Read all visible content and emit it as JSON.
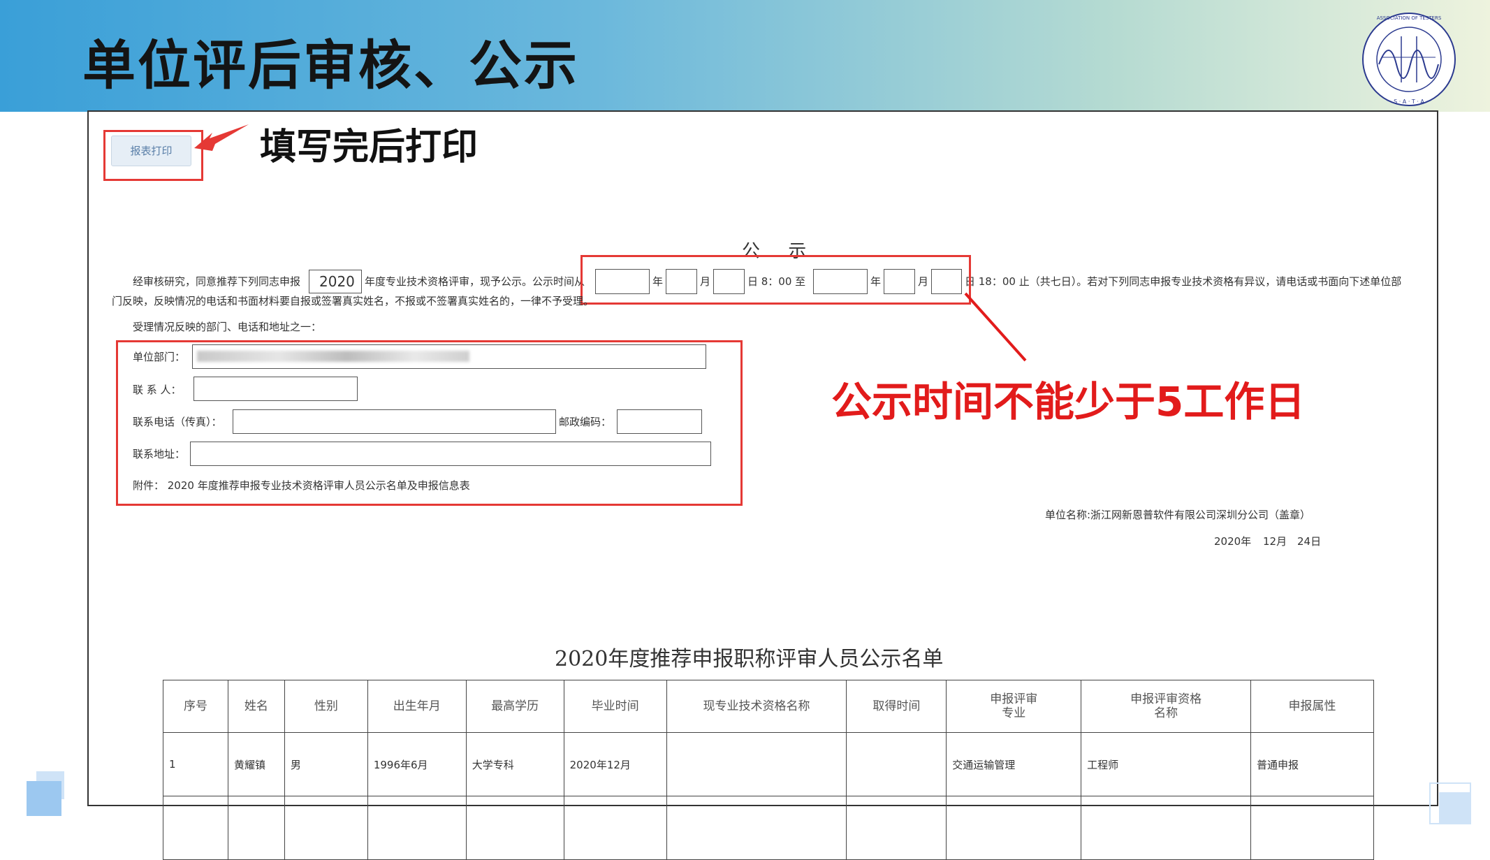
{
  "slide": {
    "title": "单位评后审核、公示"
  },
  "toolbar": {
    "print_label": "报表打印"
  },
  "captions": {
    "print": "填写完后打印",
    "duration": "公示时间不能少于5工作日"
  },
  "notice": {
    "title": "公 示",
    "line1_a": "经审核研究，同意推荐下列同志申报",
    "year_value": "2020",
    "line1_b": "年度专业技术资格评审，现予公示。公示时间从",
    "year_unit": "年",
    "month_unit": "月",
    "from_time": "日 8：00 至",
    "to_time": "日 18：00 止（共七日）。若对下列同志申报专业技术资格有异议，请电话或书面向下述单位部",
    "line2": "门反映，反映情况的电话和书面材料要自报或签署真实姓名，不报或不签署真实姓名的，一律不予受理。",
    "dept_intro": "受理情况反映的部门、电话和地址之一："
  },
  "form": {
    "dept_label": "单位部门：",
    "contact_label": "联 系 人：",
    "phone_label": "联系电话（传真）：",
    "zip_label": "邮政编码：",
    "address_label": "联系地址：",
    "attachment": "附件： 2020 年度推荐申报专业技术资格评审人员公示名单及申报信息表"
  },
  "signature": {
    "unit": "单位名称:浙江网新恩普软件有限公司深圳分公司（盖章）",
    "date_year": "2020年",
    "date_month": "12月",
    "date_day": "24日"
  },
  "roster": {
    "title": "2020年度推荐申报职称评审人员公示名单",
    "headers": [
      {
        "l1": "序号",
        "l2": ""
      },
      {
        "l1": "姓名",
        "l2": ""
      },
      {
        "l1": "性别",
        "l2": ""
      },
      {
        "l1": "出生年月",
        "l2": ""
      },
      {
        "l1": "最高学历",
        "l2": ""
      },
      {
        "l1": "毕业时间",
        "l2": ""
      },
      {
        "l1": "现专业技术资格名称",
        "l2": ""
      },
      {
        "l1": "取得时间",
        "l2": ""
      },
      {
        "l1": "申报评审",
        "l2": "专业"
      },
      {
        "l1": "申报评审资格",
        "l2": "名称"
      },
      {
        "l1": "申报属性",
        "l2": ""
      }
    ],
    "rows": [
      [
        "1",
        "黄耀镇",
        "男",
        "1996年6月",
        "大学专科",
        "2020年12月",
        "",
        "",
        "交通运输管理",
        "工程师",
        "普通申报"
      ]
    ]
  },
  "logo": {
    "icon": "sata-seal-icon",
    "text": "SHENZHEN ASSOCIATION OF TESTERS AND ANALYSIS · S · A · T · A"
  },
  "colors": {
    "accent_red": "#e53935",
    "banner_start": "#3a9fd8",
    "banner_end": "#eef3de"
  }
}
